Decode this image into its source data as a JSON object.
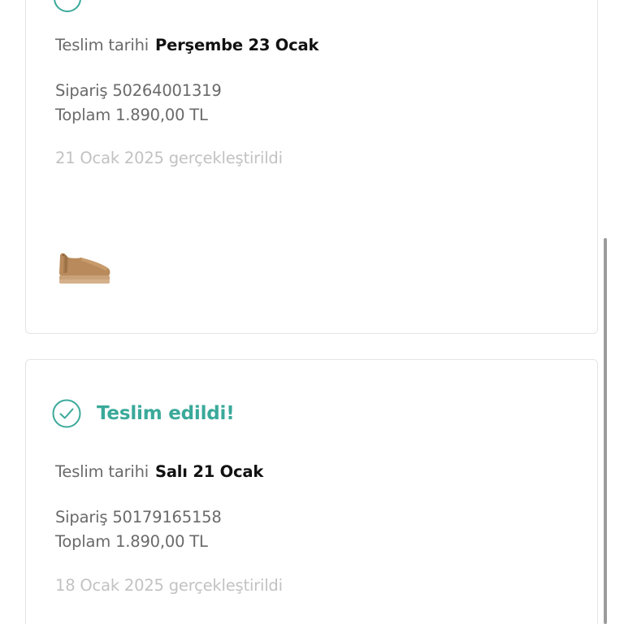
{
  "orders": [
    {
      "status_label": "",
      "delivery_label": "Teslim tarihi",
      "delivery_date": "Perşembe 23 Ocak",
      "order_label": "Sipariş 50264001319",
      "total_label": "Toplam 1.890,00 TL",
      "placed_label": "21 Ocak 2025 gerçekleştirildi",
      "product_image": "tan-suede-ankle-boot"
    },
    {
      "status_label": "Teslim edildi!",
      "delivery_label": "Teslim tarihi",
      "delivery_date": "Salı 21 Ocak",
      "order_label": "Sipariş 50179165158",
      "total_label": "Toplam 1.890,00 TL",
      "placed_label": "18 Ocak 2025 gerçekleştirildi"
    }
  ],
  "colors": {
    "accent": "#3aa99a",
    "text": "#6a6a6a",
    "strong_text": "#111111",
    "muted_text": "#c2c2c2",
    "border": "#e4e4e4"
  },
  "icons": {
    "status": "check-circle-icon"
  }
}
